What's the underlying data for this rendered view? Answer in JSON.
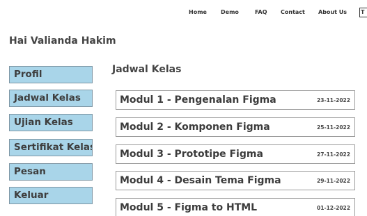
{
  "nav": {
    "links": [
      "Home",
      "Demo",
      "FAQ",
      "Contact",
      "About Us"
    ],
    "extra_glyph": "T"
  },
  "greeting": "Hai Valianda Hakim",
  "sidebar": {
    "items": [
      {
        "label": "Profil"
      },
      {
        "label": "Jadwal Kelas"
      },
      {
        "label": "Ujian Kelas"
      },
      {
        "label": "Sertifikat Kelas"
      },
      {
        "label": "Pesan"
      },
      {
        "label": "Keluar"
      }
    ]
  },
  "main": {
    "title": "Jadwal Kelas",
    "modules": [
      {
        "title": "Modul 1 - Pengenalan Figma",
        "date": "23-11-2022"
      },
      {
        "title": "Modul 2 - Komponen Figma",
        "date": "25-11-2022"
      },
      {
        "title": "Modul 3 - Prototipe Figma",
        "date": "27-11-2022"
      },
      {
        "title": "Modul 4 - Desain Tema Figma",
        "date": "29-11-2022"
      },
      {
        "title": "Modul 5 - Figma to HTML",
        "date": "01-12-2022"
      }
    ]
  },
  "colors": {
    "sidebar_button_bg": "#a9d5e9",
    "sidebar_button_border": "#7e96a4",
    "module_border": "#999999"
  }
}
